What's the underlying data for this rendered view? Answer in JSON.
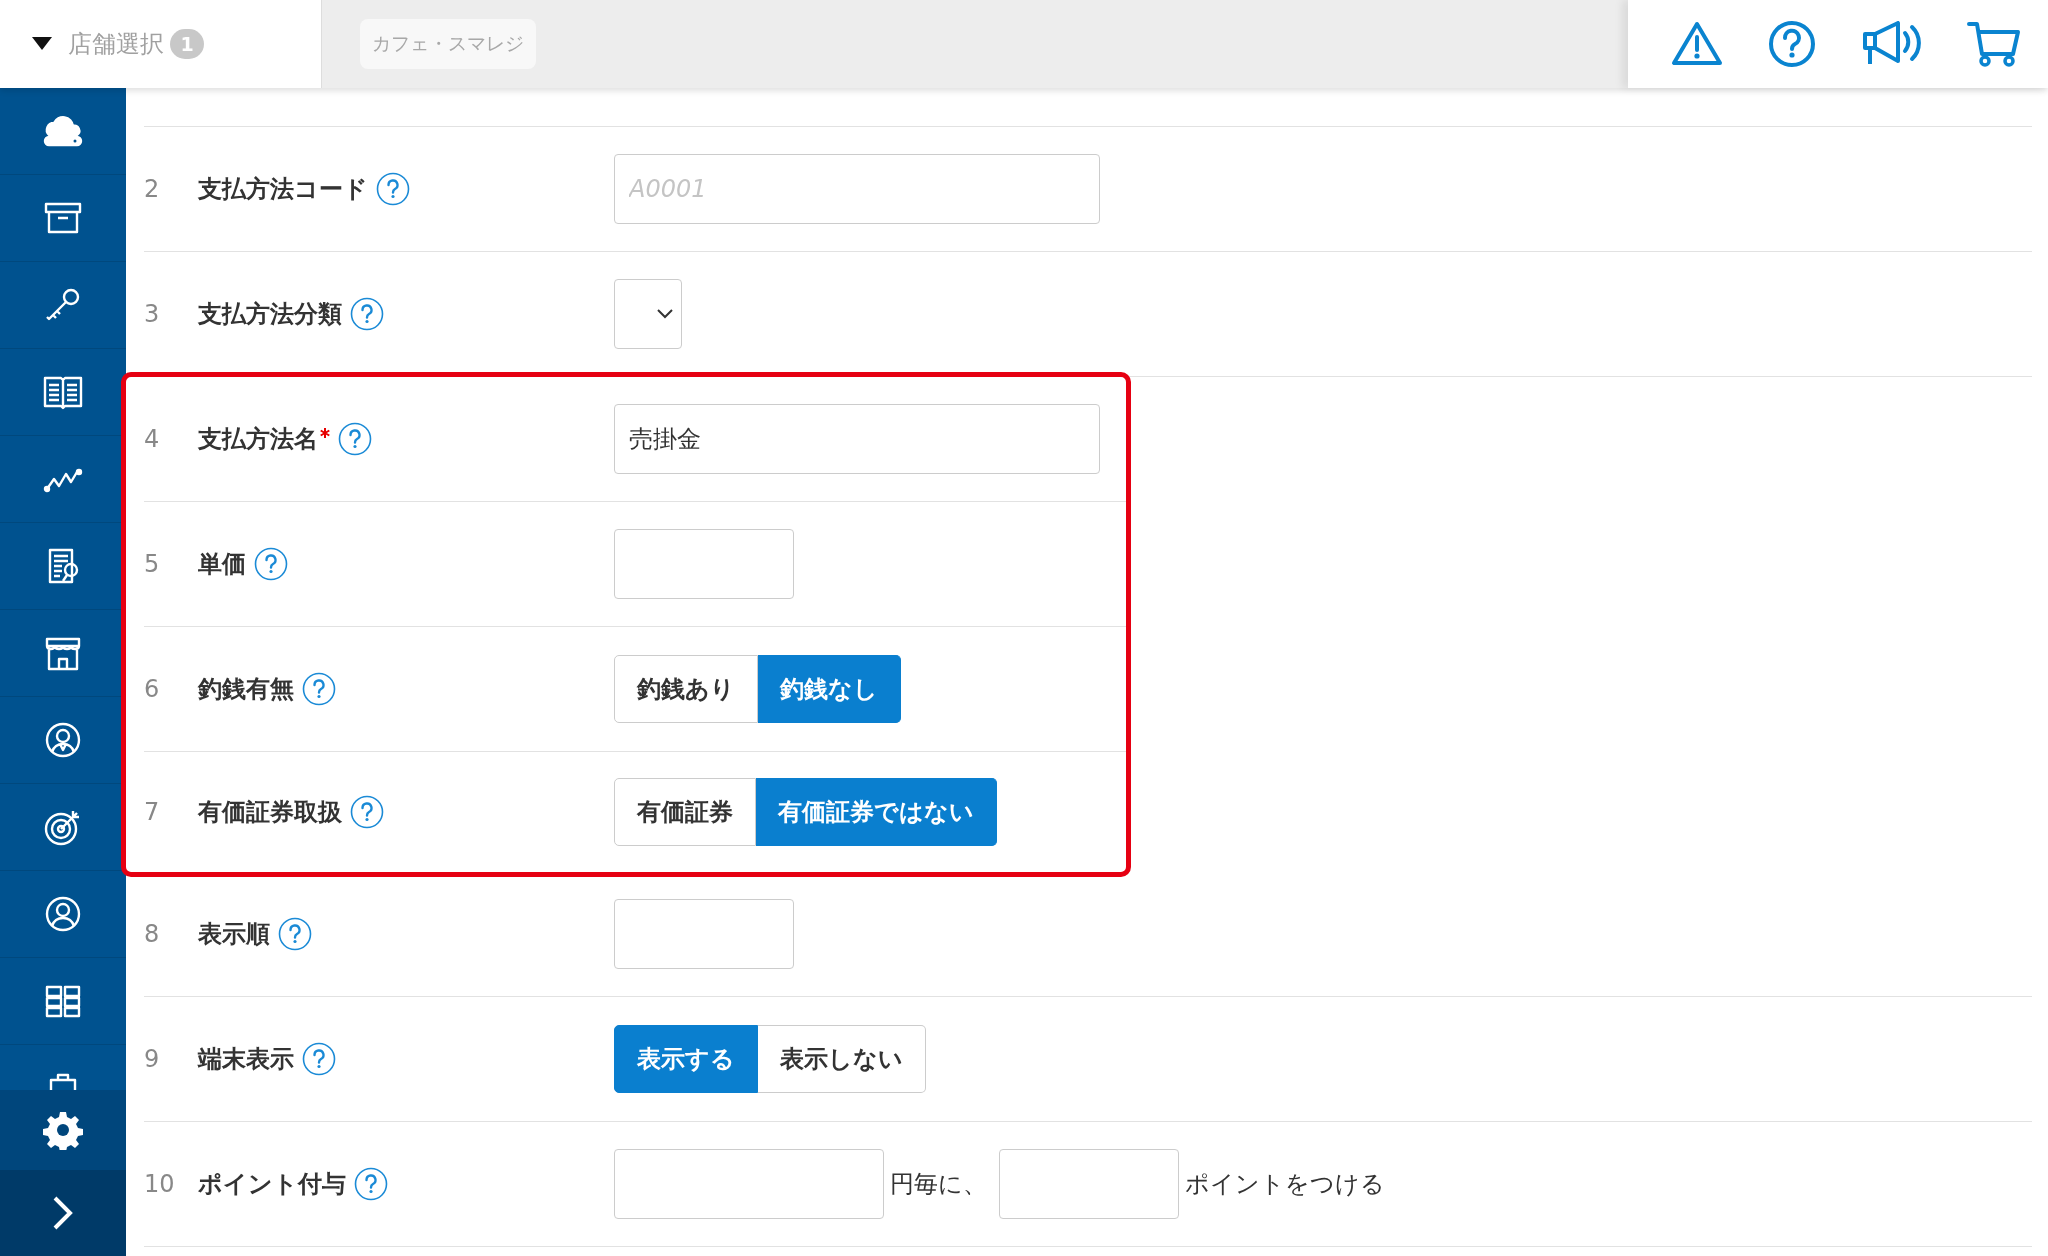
{
  "header": {
    "store_select": {
      "label": "店舗選択",
      "count": "1"
    },
    "store_chip": "カフェ・スマレジ"
  },
  "sidebar": {
    "items": [
      {
        "kind": "cloud"
      },
      {
        "kind": "box"
      },
      {
        "kind": "key"
      },
      {
        "kind": "book"
      },
      {
        "kind": "chart"
      },
      {
        "kind": "report"
      },
      {
        "kind": "shop"
      },
      {
        "kind": "staff"
      },
      {
        "kind": "target"
      },
      {
        "kind": "user"
      },
      {
        "kind": "grid"
      },
      {
        "kind": "clipboard"
      }
    ],
    "settings": {
      "kind": "gear"
    },
    "expand": {
      "kind": "chevron"
    }
  },
  "form": {
    "rows": [
      {
        "number": "2",
        "label": "支払方法コード",
        "required": false,
        "highlighted": false,
        "kind": "wide_text",
        "placeholder": "A0001"
      },
      {
        "number": "3",
        "label": "支払方法分類",
        "required": false,
        "highlighted": false,
        "kind": "select"
      },
      {
        "number": "4",
        "label": "支払方法名",
        "required": true,
        "highlighted": true,
        "kind": "wide_text",
        "value": "売掛金"
      },
      {
        "number": "5",
        "label": "単価",
        "required": false,
        "highlighted": true,
        "kind": "short_text"
      },
      {
        "number": "6",
        "label": "釣銭有無",
        "required": false,
        "highlighted": true,
        "kind": "toggle",
        "options": [
          {
            "label": "釣銭あり",
            "selected": false
          },
          {
            "label": "釣銭なし",
            "selected": true
          }
        ]
      },
      {
        "number": "7",
        "label": "有価証券取扱",
        "required": false,
        "highlighted": true,
        "kind": "toggle",
        "options": [
          {
            "label": "有価証券",
            "selected": false
          },
          {
            "label": "有価証券ではない",
            "selected": true
          }
        ]
      },
      {
        "number": "8",
        "label": "表示順",
        "required": false,
        "highlighted": false,
        "kind": "short_text"
      },
      {
        "number": "9",
        "label": "端末表示",
        "required": false,
        "highlighted": false,
        "kind": "toggle",
        "options": [
          {
            "label": "表示する",
            "selected": true
          },
          {
            "label": "表示しない",
            "selected": false
          }
        ]
      },
      {
        "number": "10",
        "label": "ポイント付与",
        "required": false,
        "highlighted": false,
        "kind": "points",
        "middle_text": "円毎に、",
        "end_text": "ポイントをつける"
      }
    ]
  }
}
